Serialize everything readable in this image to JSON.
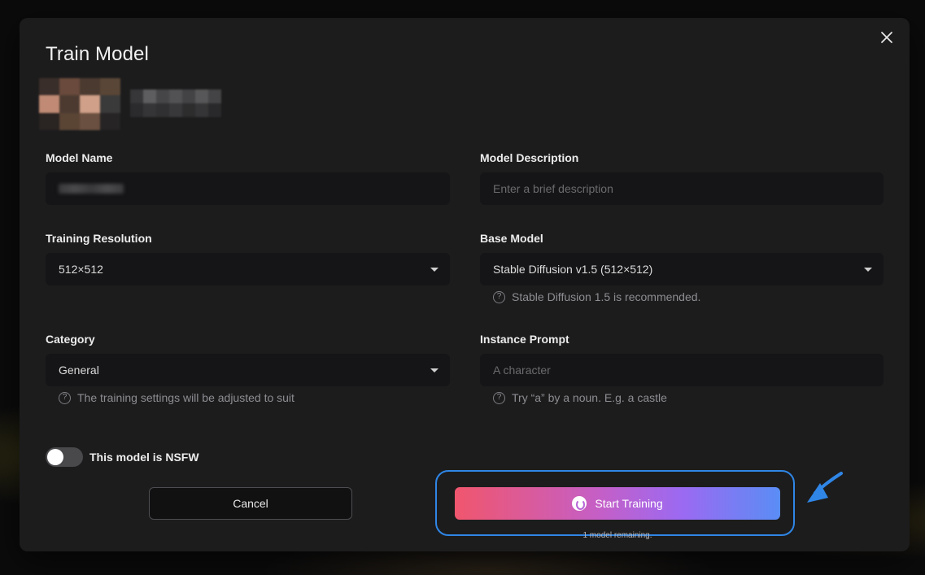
{
  "modal": {
    "title": "Train Model"
  },
  "form": {
    "model_name": {
      "label": "Model Name"
    },
    "model_description": {
      "label": "Model Description",
      "placeholder": "Enter a brief description"
    },
    "training_resolution": {
      "label": "Training Resolution",
      "value": "512×512"
    },
    "base_model": {
      "label": "Base Model",
      "value": "Stable Diffusion v1.5 (512×512)",
      "hint": "Stable Diffusion 1.5 is recommended."
    },
    "category": {
      "label": "Category",
      "value": "General",
      "hint": "The training settings will be adjusted to suit"
    },
    "instance_prompt": {
      "label": "Instance Prompt",
      "placeholder": "A character",
      "hint": "Try “a” by a noun. E.g. a castle"
    },
    "nsfw_toggle": {
      "label": "This model is NSFW",
      "checked": false
    }
  },
  "actions": {
    "cancel_label": "Cancel",
    "start_label": "Start Training",
    "remaining_text": "1 model remaining."
  },
  "icons": {
    "close": "close-icon",
    "help": "question-circle-icon",
    "dropdown": "chevron-down-icon",
    "start": "brand-logo-icon",
    "annotation": "arrow-pointer-icon"
  },
  "colors": {
    "modal_bg": "#1c1c1d",
    "field_bg": "#151517",
    "highlight_border": "#2f86e6",
    "button_gradient_start": "#f0566d",
    "button_gradient_end": "#5a8df5"
  }
}
